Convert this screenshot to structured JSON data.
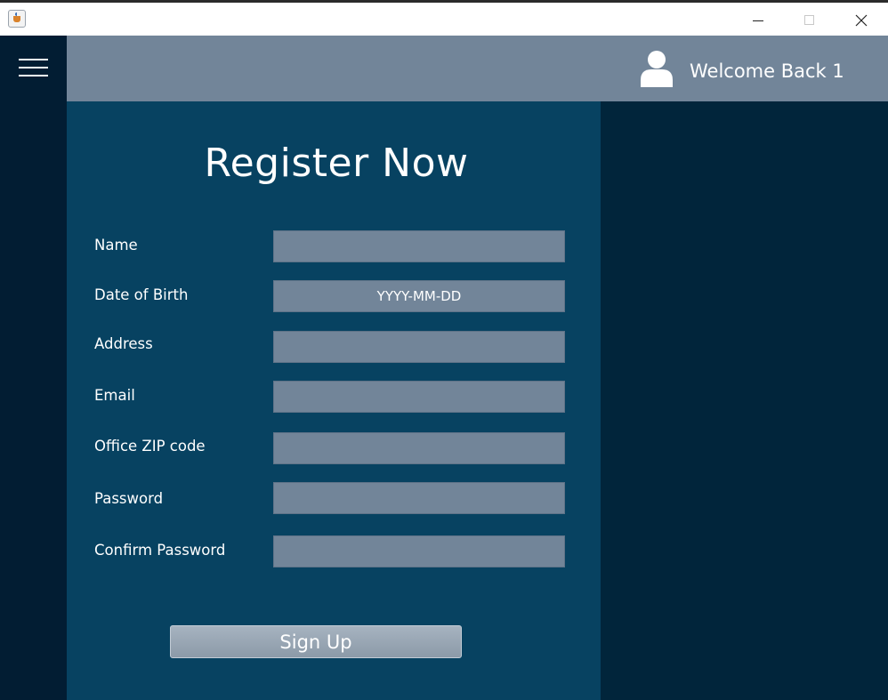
{
  "header": {
    "welcome_text": "Welcome Back 1"
  },
  "form": {
    "title": "Register Now",
    "fields": [
      {
        "label": "Name",
        "value": "",
        "placeholder": ""
      },
      {
        "label": "Date of Birth",
        "value": "",
        "placeholder": "YYYY-MM-DD"
      },
      {
        "label": "Address",
        "value": "",
        "placeholder": ""
      },
      {
        "label": "Email",
        "value": "",
        "placeholder": ""
      },
      {
        "label": "Office ZIP code",
        "value": "",
        "placeholder": ""
      },
      {
        "label": "Password",
        "value": "",
        "placeholder": ""
      },
      {
        "label": "Confirm Password",
        "value": "",
        "placeholder": ""
      }
    ],
    "submit_label": "Sign Up"
  },
  "icons": {
    "app": "java-app-icon",
    "menu": "hamburger-menu-icon",
    "user": "user-icon",
    "minimize": "minimize-icon",
    "maximize": "maximize-icon",
    "close": "close-icon"
  },
  "colors": {
    "sidebar": "#021d33",
    "header": "#728599",
    "form_panel": "#074261",
    "right_panel": "#01253b",
    "input_background": "#728599",
    "text": "#ffffff"
  }
}
